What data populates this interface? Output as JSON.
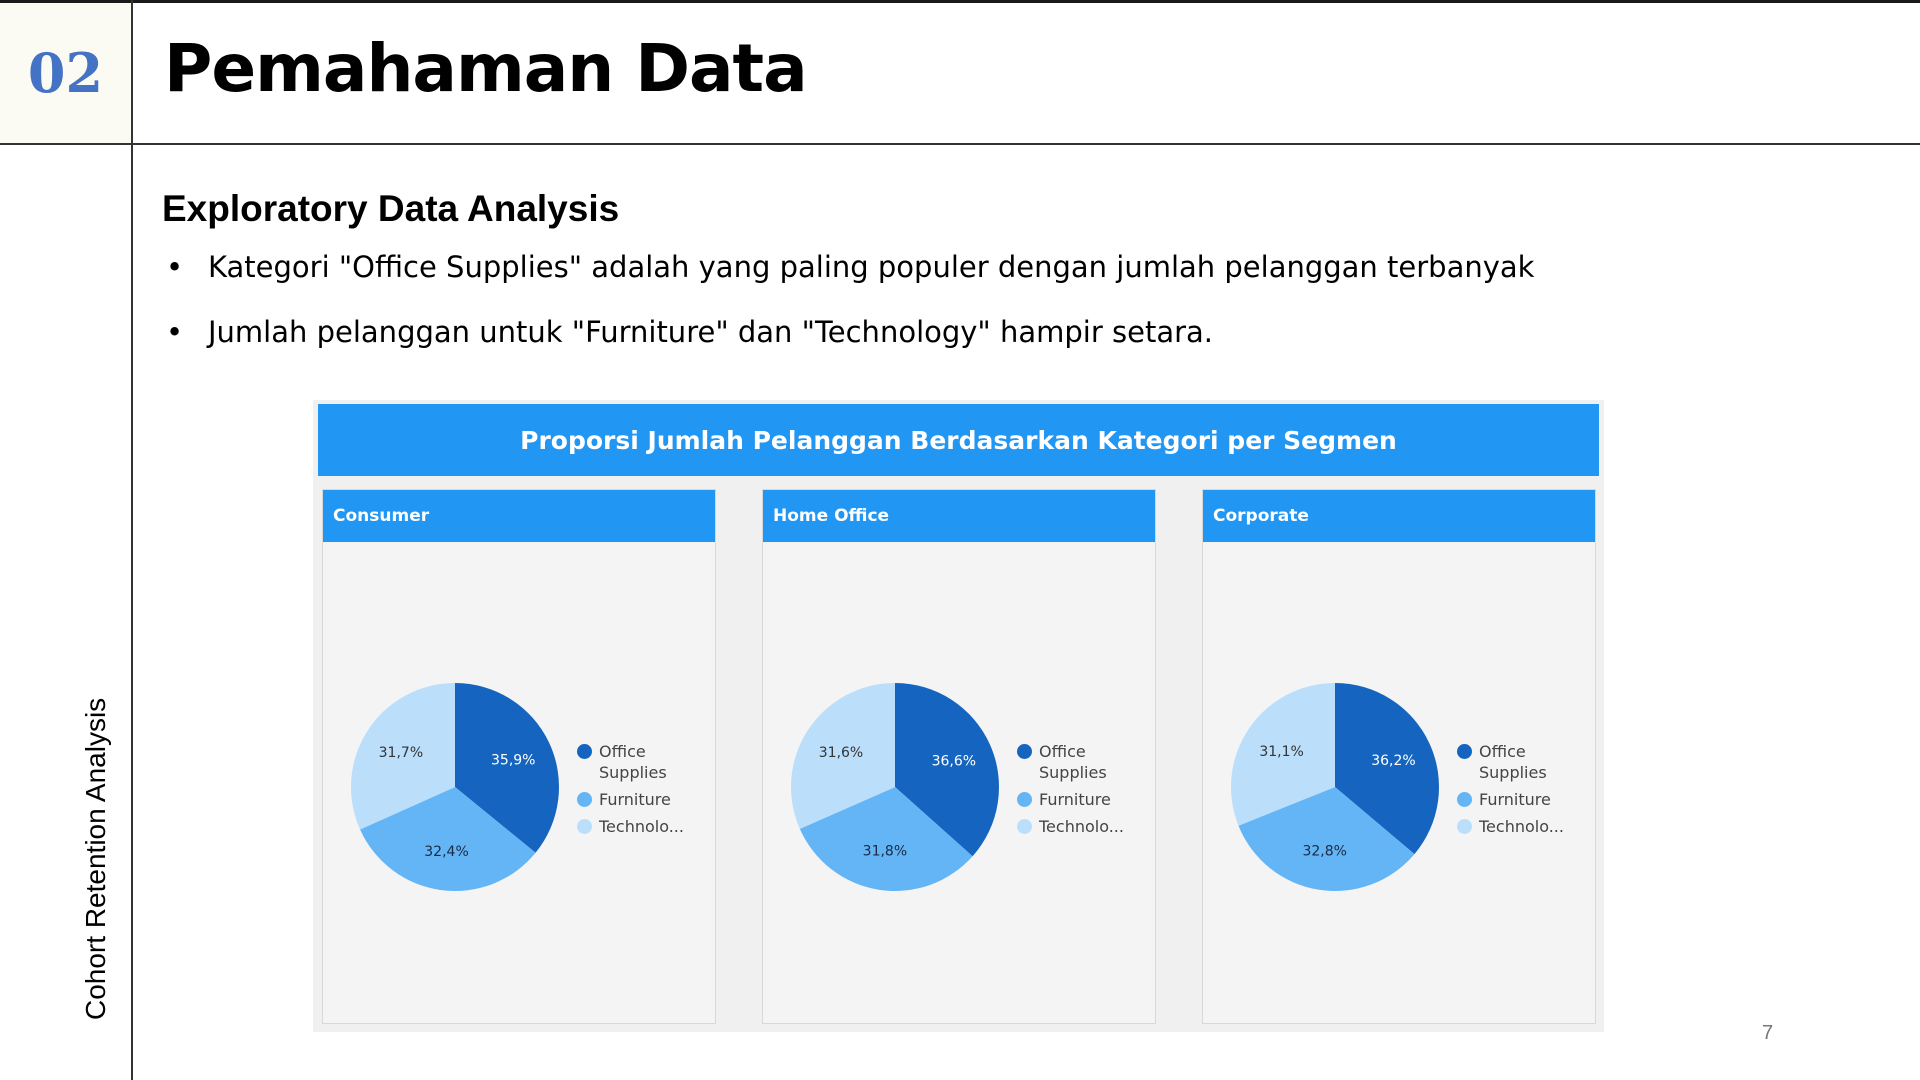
{
  "slide": {
    "number": "02",
    "title": "Pemahaman Data",
    "side_label": "Cohort Retention Analysis",
    "section_heading": "Exploratory Data Analysis",
    "bullets": [
      "Kategori \"Office Supplies\" adalah yang paling populer dengan jumlah pelanggan terbanyak",
      "Jumlah pelanggan untuk \"Furniture\" dan \"Technology\" hampir setara."
    ],
    "page_number": "7"
  },
  "dashboard": {
    "title": "Proporsi Jumlah Pelanggan Berdasarkan Kategori per Segmen"
  },
  "colors": {
    "header_blue": "#2196f3",
    "office_supplies": "#1565c0",
    "furniture": "#64b5f6",
    "technology": "#bbdefb",
    "slide_number": "#4472c4"
  },
  "chart_data": [
    {
      "type": "pie",
      "title": "Consumer",
      "categories": [
        "Office Supplies",
        "Furniture",
        "Technolo..."
      ],
      "values": [
        35.9,
        32.4,
        31.7
      ],
      "labels": [
        "35,9%",
        "32,4%",
        "31,7%"
      ],
      "legend": "right"
    },
    {
      "type": "pie",
      "title": "Home Office",
      "categories": [
        "Office Supplies",
        "Furniture",
        "Technolo..."
      ],
      "values": [
        36.6,
        31.8,
        31.6
      ],
      "labels": [
        "36,6%",
        "31,8%",
        "31,6%"
      ],
      "legend": "right"
    },
    {
      "type": "pie",
      "title": "Corporate",
      "categories": [
        "Office Supplies",
        "Furniture",
        "Technolo..."
      ],
      "values": [
        36.2,
        32.8,
        31.1
      ],
      "labels": [
        "36,2%",
        "32,8%",
        "31,1%"
      ],
      "legend": "right"
    }
  ]
}
